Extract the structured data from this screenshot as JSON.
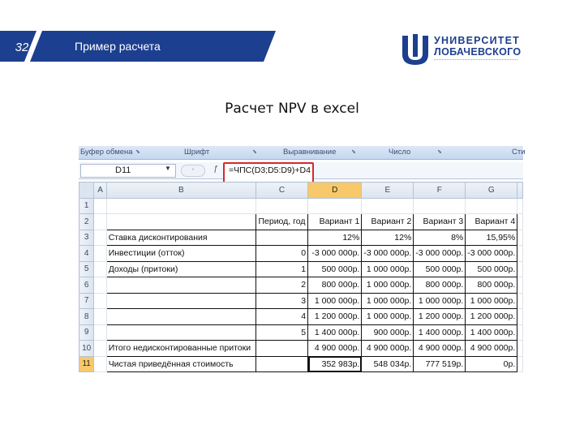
{
  "header": {
    "slide_number": "32",
    "slide_title": "Пример расчета",
    "band_color": "#1d3f8f"
  },
  "logo": {
    "line1": "УНИВЕРСИТЕТ",
    "line2": "ЛОБАЧЕВСКОГО",
    "brand_color": "#1d3f8f"
  },
  "heading": "Расчет NPV в excel",
  "excel": {
    "ribbon": {
      "groups": [
        "Буфер обмена",
        "Шрифт",
        "Выравнивание",
        "Число",
        "Сти"
      ]
    },
    "name_box": "D11",
    "formula": "=ЧПС(D3;D5:D9)+D4",
    "column_headers": [
      "A",
      "B",
      "C",
      "D",
      "E",
      "F",
      "G"
    ],
    "selected_column": "D",
    "selected_row": "11",
    "rows": [
      {
        "n": "1",
        "b": "",
        "c": "",
        "d": "",
        "e": "",
        "f": "",
        "g": ""
      },
      {
        "n": "2",
        "b": "",
        "c": "Период, год",
        "d": "Вариант 1",
        "e": "Вариант 2",
        "f": "Вариант 3",
        "g": "Вариант 4"
      },
      {
        "n": "3",
        "b": "Ставка дисконтирования",
        "c": "",
        "d": "12%",
        "e": "12%",
        "f": "8%",
        "g": "15,95%"
      },
      {
        "n": "4",
        "b": "Инвестиции (отток)",
        "c": "0",
        "d": "-3 000 000р.",
        "e": "-3 000 000р.",
        "f": "-3 000 000р.",
        "g": "-3 000 000р."
      },
      {
        "n": "5",
        "b": "Доходы (притоки)",
        "c": "1",
        "d": "500 000р.",
        "e": "1 000 000р.",
        "f": "500 000р.",
        "g": "500 000р."
      },
      {
        "n": "6",
        "b": "",
        "c": "2",
        "d": "800 000р.",
        "e": "1 000 000р.",
        "f": "800 000р.",
        "g": "800 000р."
      },
      {
        "n": "7",
        "b": "",
        "c": "3",
        "d": "1 000 000р.",
        "e": "1 000 000р.",
        "f": "1 000 000р.",
        "g": "1 000 000р."
      },
      {
        "n": "8",
        "b": "",
        "c": "4",
        "d": "1 200 000р.",
        "e": "1 000 000р.",
        "f": "1 200 000р.",
        "g": "1 200 000р."
      },
      {
        "n": "9",
        "b": "",
        "c": "5",
        "d": "1 400 000р.",
        "e": "900 000р.",
        "f": "1 400 000р.",
        "g": "1 400 000р."
      },
      {
        "n": "10",
        "b": "Итого недисконтированные притоки",
        "c": "",
        "d": "4 900 000р.",
        "e": "4 900 000р.",
        "f": "4 900 000р.",
        "g": "4 900 000р."
      },
      {
        "n": "11",
        "b": "Чистая приведённая стоимость",
        "c": "",
        "d": "352 983р.",
        "e": "548 034р.",
        "f": "777 519р.",
        "g": "0р."
      }
    ]
  }
}
